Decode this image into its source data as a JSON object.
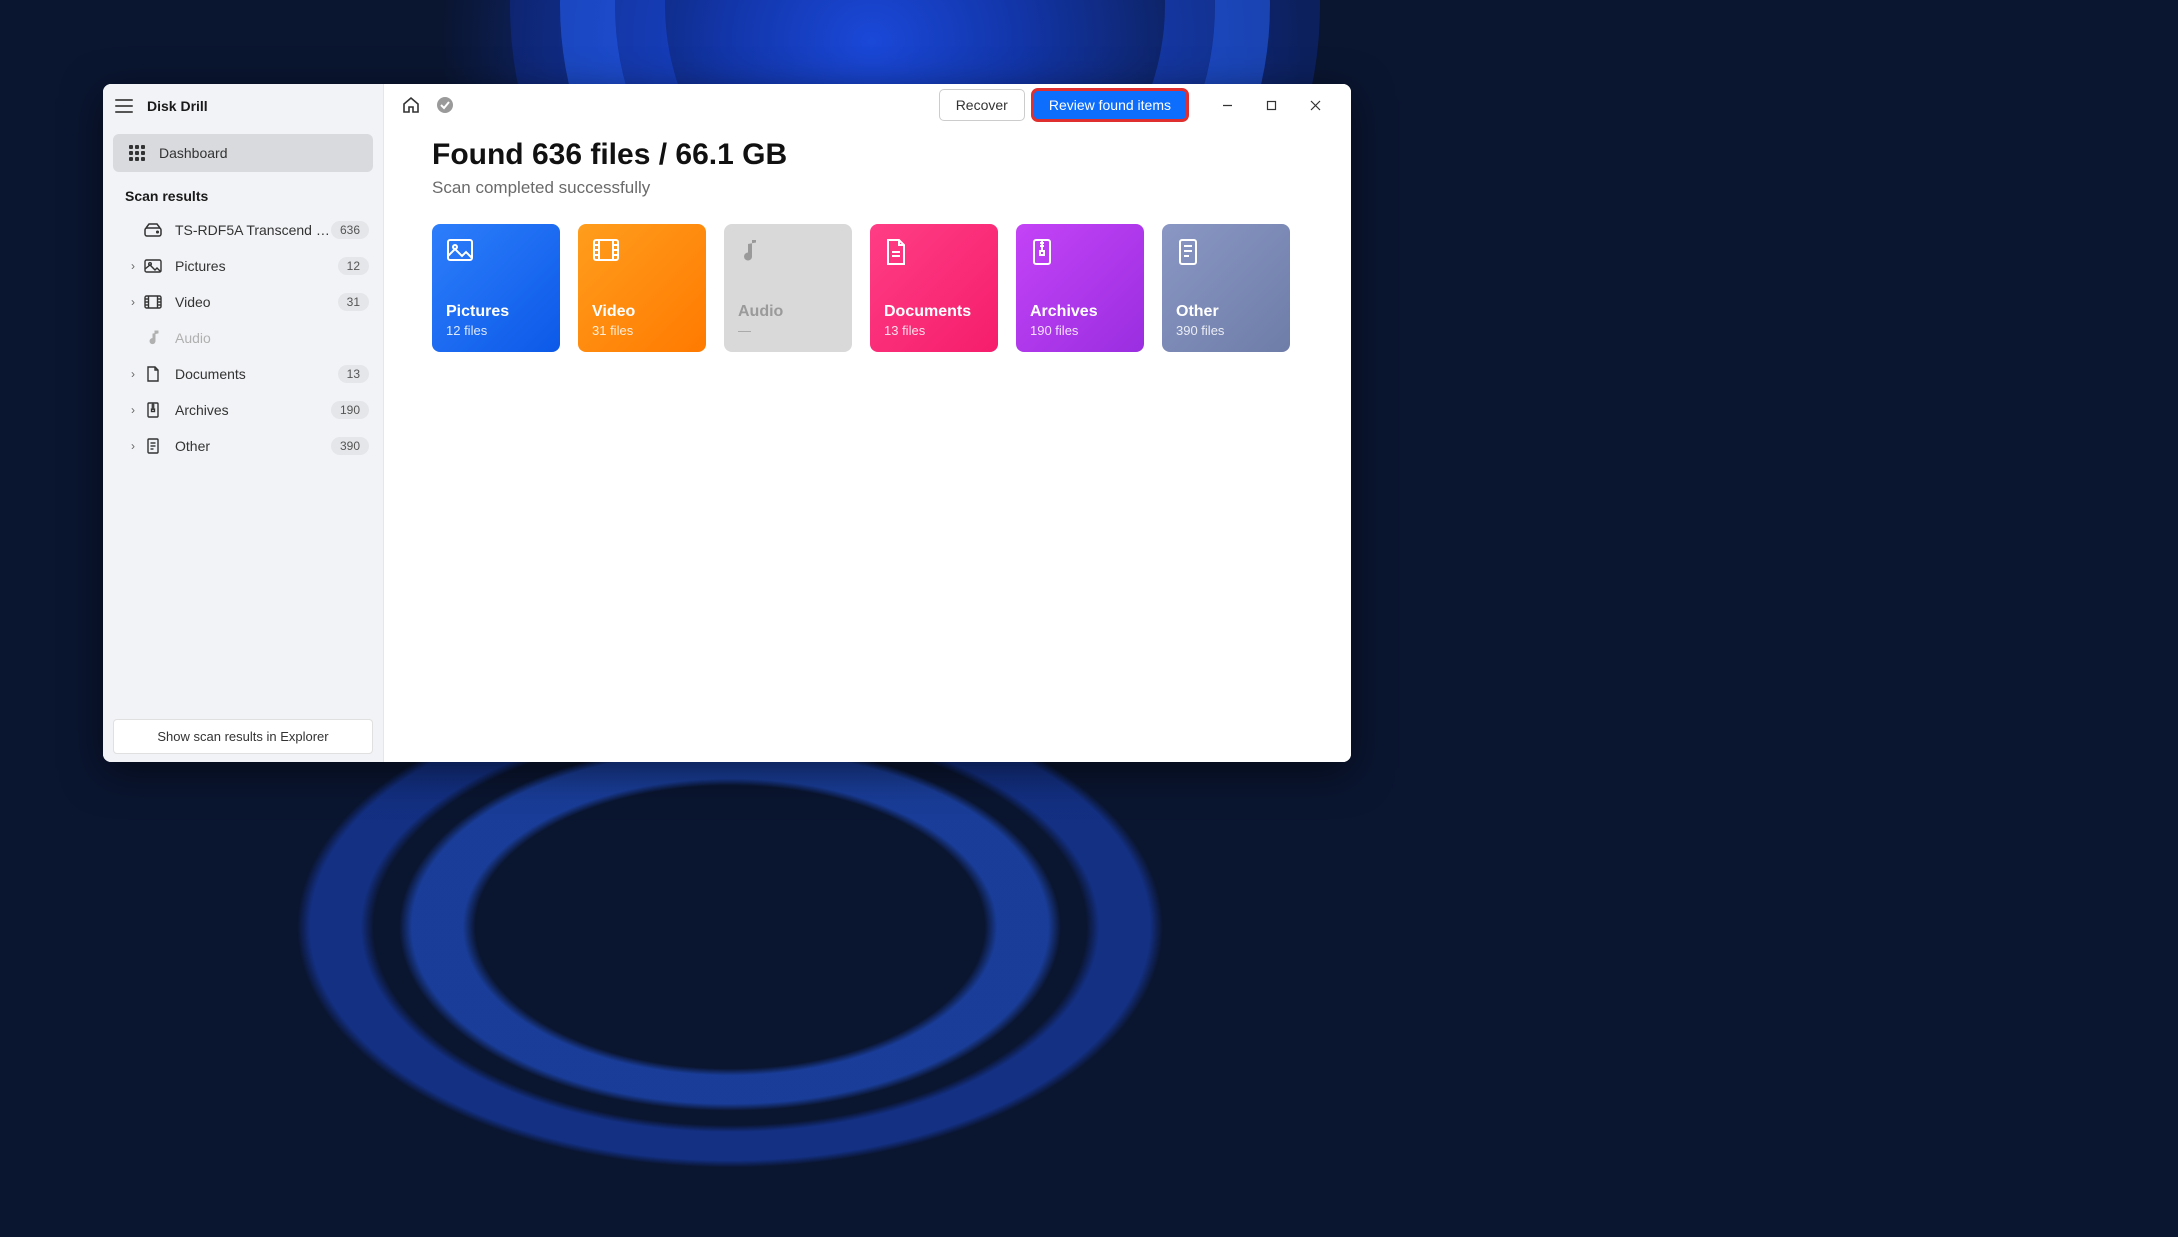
{
  "app": {
    "title": "Disk Drill"
  },
  "sidebar": {
    "dashboard_label": "Dashboard",
    "section_label": "Scan results",
    "device": {
      "label": "TS-RDF5A Transcend US…",
      "count": "636"
    },
    "items": [
      {
        "label": "Pictures",
        "count": "12"
      },
      {
        "label": "Video",
        "count": "31"
      },
      {
        "label": "Audio",
        "count": ""
      },
      {
        "label": "Documents",
        "count": "13"
      },
      {
        "label": "Archives",
        "count": "190"
      },
      {
        "label": "Other",
        "count": "390"
      }
    ],
    "footer_label": "Show scan results in Explorer"
  },
  "topbar": {
    "recover_label": "Recover",
    "review_label": "Review found items"
  },
  "headline": "Found 636 files / 66.1 GB",
  "subhead": "Scan completed successfully",
  "cards": [
    {
      "title": "Pictures",
      "count": "12 files"
    },
    {
      "title": "Video",
      "count": "31 files"
    },
    {
      "title": "Audio",
      "count": "—"
    },
    {
      "title": "Documents",
      "count": "13 files"
    },
    {
      "title": "Archives",
      "count": "190 files"
    },
    {
      "title": "Other",
      "count": "390 files"
    }
  ]
}
